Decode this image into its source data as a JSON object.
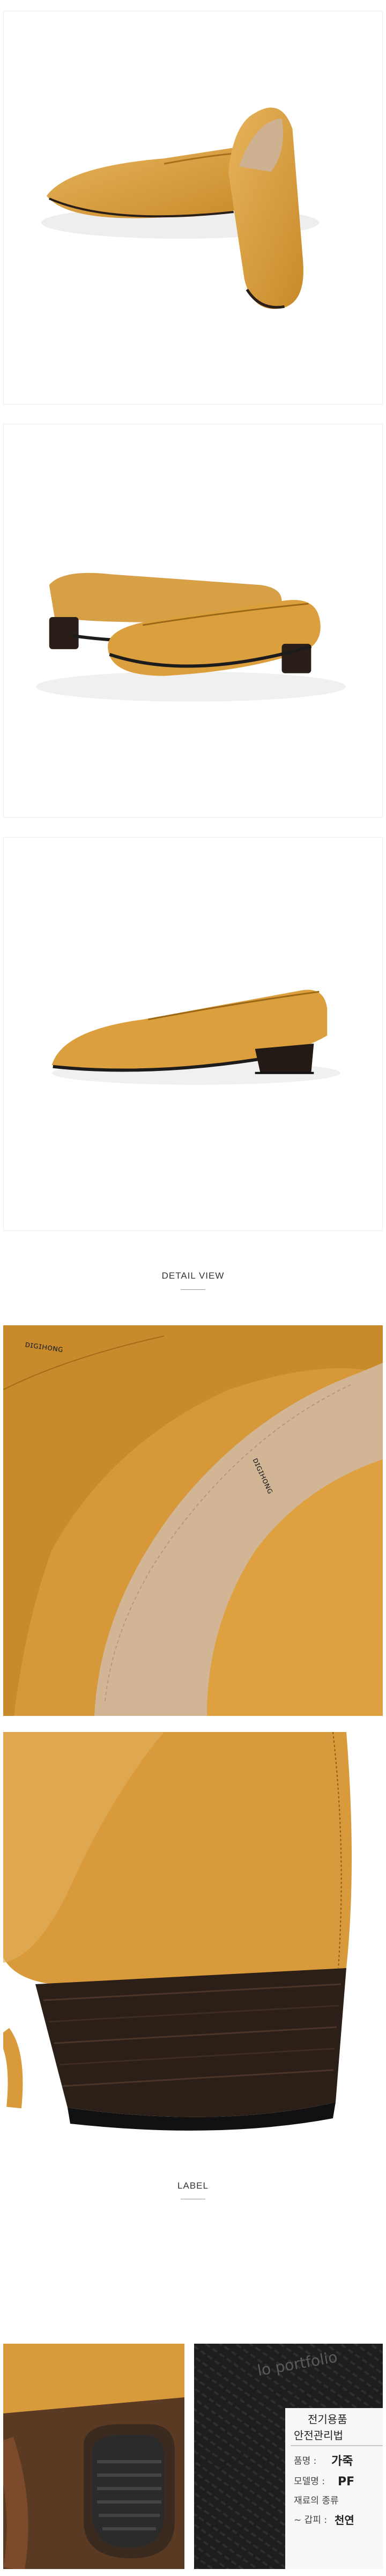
{
  "sections": {
    "detail_title": "DETAIL VIEW",
    "label_title": "LABEL"
  },
  "colors": {
    "leather": "#d79a3a",
    "leather_dark": "#b87a20",
    "leather_light": "#e8b867",
    "lining": "#cdb190",
    "heel": "#2a1e18",
    "sole": "#1c1c1c"
  },
  "insole_print": {
    "brand_left": "ᴅɪɢɪʜᴏɴɢ",
    "brand_right": "ᴅɪɢɪʜᴏɴɢ"
  },
  "outsole_print": {
    "brand": "lo portfolio"
  },
  "safety_label": {
    "line1": "전기용품",
    "line2": "안전관리법",
    "row1_key": "품명 :",
    "row1_val": "가죽",
    "row2_key": "모델명 :",
    "row2_val": "PF",
    "row3_key": "재료의 종류",
    "row4_key": "~ 갑피 :",
    "row4_val": "천연"
  }
}
